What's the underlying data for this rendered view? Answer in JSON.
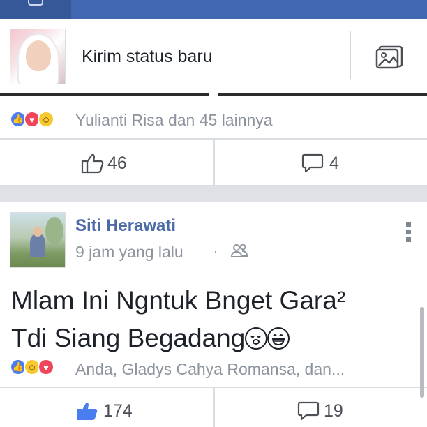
{
  "composer": {
    "prompt": "Kirim status baru"
  },
  "post1": {
    "reactions_text": "Yulianti Risa dan 45 lainnya",
    "like_count": "46",
    "comment_count": "4"
  },
  "post2": {
    "author": "Siti Herawati",
    "time": "9 jam yang lalu",
    "separator": "·",
    "body_line1": "Mlam Ini Ngntuk Bnget Gara²",
    "body_line2": "Tdi Siang Begadang",
    "reactions_text": "Anda, Gladys Cahya Romansa, dan...",
    "like_count": "174",
    "comment_count": "19"
  },
  "colors": {
    "nav": "#4267b2",
    "link": "#4b6aa6",
    "like": "#4a7ef0",
    "love": "#f0455a",
    "haha": "#f7c930"
  },
  "icons": {
    "photo": "photo-icon",
    "like": "thumbs-up-icon",
    "comment": "comment-icon",
    "audience": "friends-icon",
    "more": "more-vertical-icon"
  }
}
